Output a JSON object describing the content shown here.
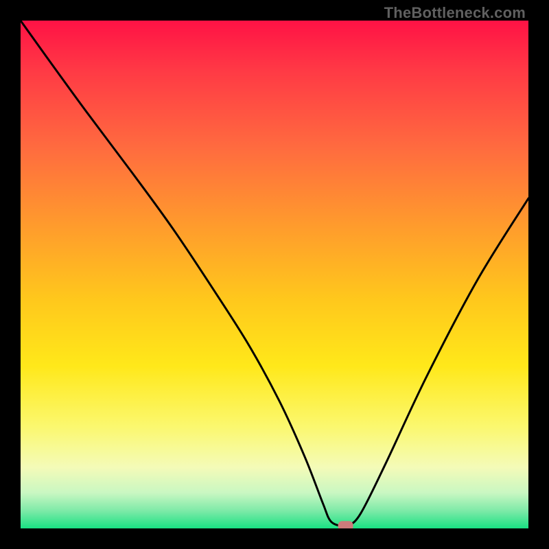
{
  "watermark": "TheBottleneck.com",
  "chart_data": {
    "type": "line",
    "title": "",
    "xlabel": "",
    "ylabel": "",
    "xlim": [
      0,
      100
    ],
    "ylim": [
      0,
      100
    ],
    "grid": false,
    "legend": false,
    "background": {
      "type": "vertical-gradient",
      "stops": [
        {
          "pos": 0.0,
          "color": "#ff1245"
        },
        {
          "pos": 0.1,
          "color": "#ff3a45"
        },
        {
          "pos": 0.25,
          "color": "#ff6b3f"
        },
        {
          "pos": 0.4,
          "color": "#ff9a2d"
        },
        {
          "pos": 0.55,
          "color": "#ffc81c"
        },
        {
          "pos": 0.68,
          "color": "#ffe81a"
        },
        {
          "pos": 0.8,
          "color": "#fbf86f"
        },
        {
          "pos": 0.88,
          "color": "#f4fbb8"
        },
        {
          "pos": 0.93,
          "color": "#c9f7c2"
        },
        {
          "pos": 0.965,
          "color": "#7eeaa8"
        },
        {
          "pos": 1.0,
          "color": "#19e183"
        }
      ]
    },
    "series": [
      {
        "name": "bottleneck-curve",
        "x": [
          0,
          5,
          13,
          22,
          30,
          38,
          45,
          51,
          56,
          59.5,
          61,
          63,
          64.5,
          67,
          72,
          80,
          90,
          100
        ],
        "values": [
          100,
          93,
          82,
          70,
          59,
          47,
          36,
          25,
          14,
          5,
          1.5,
          0.5,
          0.5,
          3,
          13,
          30,
          49,
          65
        ]
      }
    ],
    "marker": {
      "name": "optimal-point",
      "x": 64,
      "y": 0.5,
      "shape": "rounded-rect",
      "color": "#cd7b7b"
    }
  }
}
